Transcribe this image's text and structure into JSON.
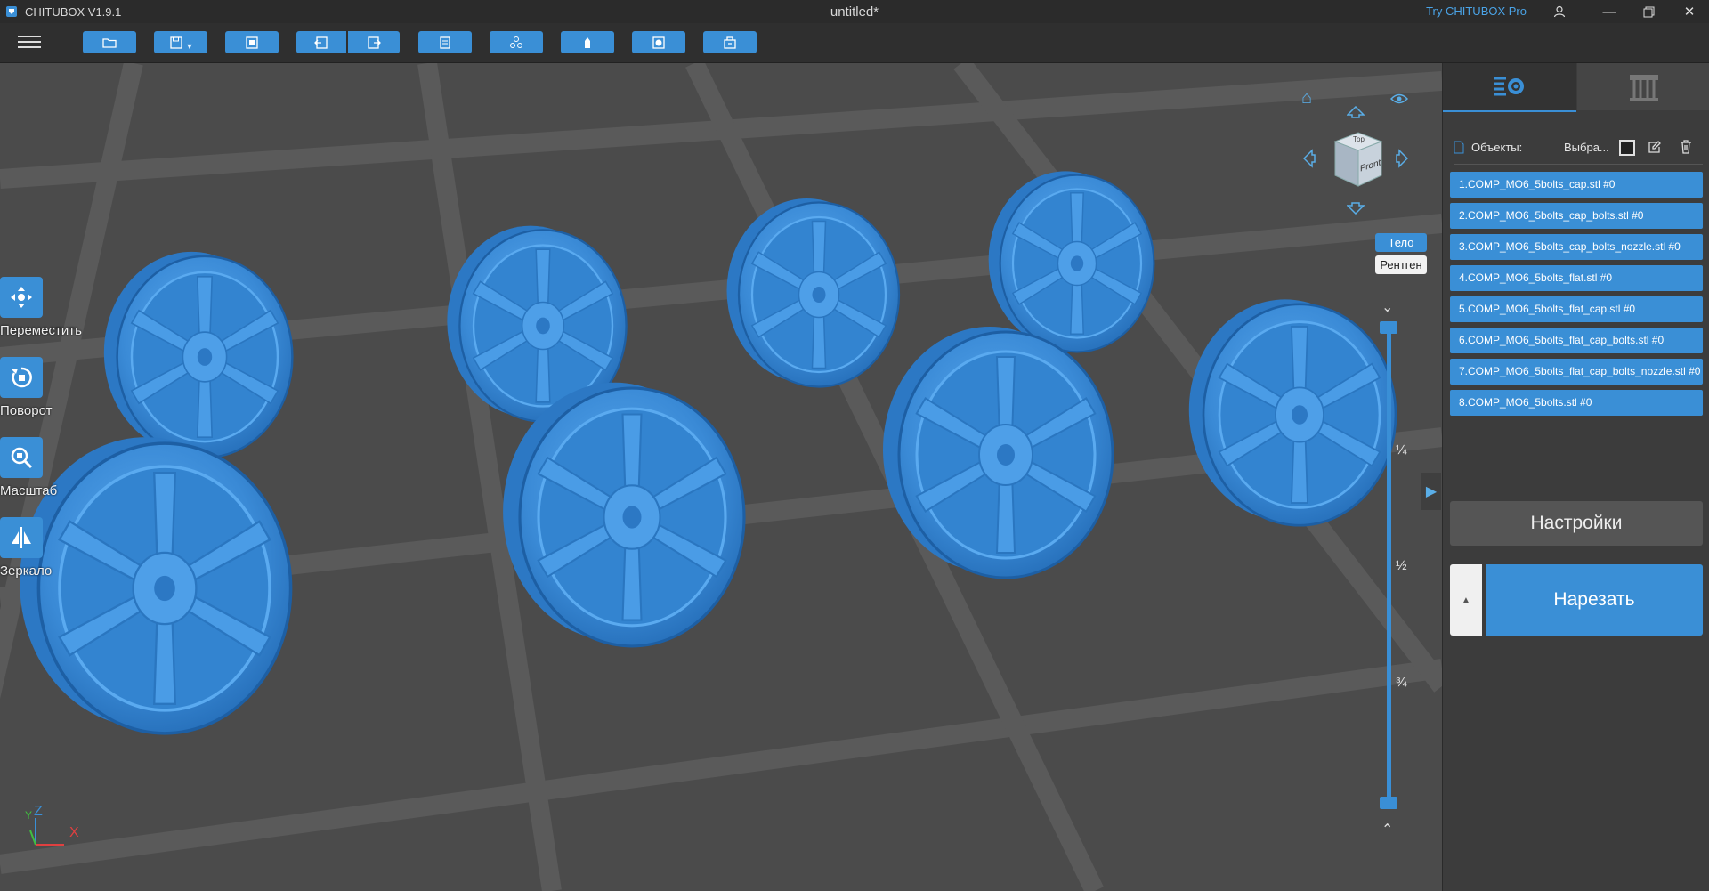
{
  "titlebar": {
    "app_name": "CHITUBOX V1.9.1",
    "document": "untitled*",
    "promo_link": "Try CHITUBOX Pro"
  },
  "toolbar": {
    "buttons": [
      "open-icon",
      "save-icon",
      "import-icon",
      "undo-icon",
      "redo-icon",
      "copy-icon",
      "arrange-icon",
      "hollow-icon",
      "dig-hole-icon",
      "export-icon"
    ]
  },
  "tools": {
    "move": "Переместить",
    "rotate": "Поворот",
    "scale": "Масштаб",
    "mirror": "Зеркало"
  },
  "nav": {
    "cube_top": "Top",
    "cube_front": "Front",
    "solid": "Тело",
    "xray": "Рентген"
  },
  "slider": {
    "quarter": "¼",
    "half": "½",
    "three_quarters": "¾"
  },
  "axes": {
    "x": "X",
    "y": "Y",
    "z": "Z"
  },
  "panel": {
    "objects_label": "Объекты:",
    "select_label": "Выбра...",
    "objects": [
      "1.COMP_MO6_5bolts_cap.stl #0",
      "2.COMP_MO6_5bolts_cap_bolts.stl #0",
      "3.COMP_MO6_5bolts_cap_bolts_nozzle.stl #0",
      "4.COMP_MO6_5bolts_flat.stl #0",
      "5.COMP_MO6_5bolts_flat_cap.stl #0",
      "6.COMP_MO6_5bolts_flat_cap_bolts.stl #0",
      "7.COMP_MO6_5bolts_flat_cap_bolts_nozzle.stl #0",
      "8.COMP_MO6_5bolts.stl #0"
    ],
    "settings_button": "Настройки",
    "slice_button": "Нарезать"
  },
  "colors": {
    "accent": "#3a8fd6",
    "model": "#3c8fd8",
    "background": "#4b4b4b"
  }
}
